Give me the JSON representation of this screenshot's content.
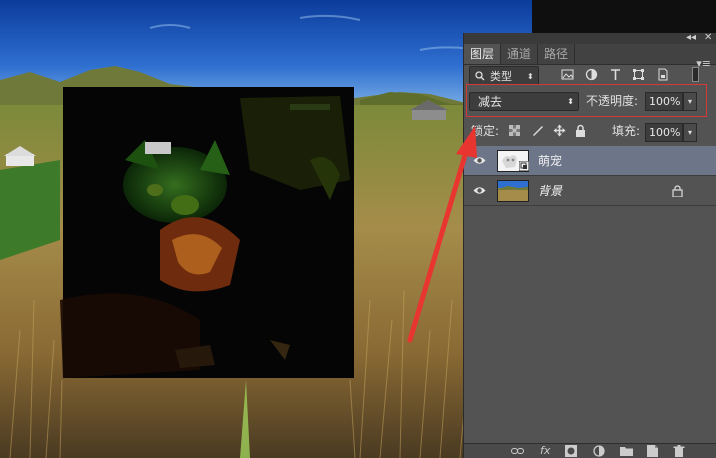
{
  "panel": {
    "tabs": [
      {
        "label": "图层",
        "active": true
      },
      {
        "label": "通道",
        "active": false
      },
      {
        "label": "路径",
        "active": false
      }
    ],
    "collapse_glyph": "◂◂",
    "close_glyph": "✕",
    "menu_glyph": "▾≡",
    "filter": {
      "kind_label": "类型",
      "icons": [
        "image-filter-icon",
        "adjustment-filter-icon",
        "type-filter-icon",
        "shape-filter-icon",
        "smart-object-filter-icon"
      ]
    },
    "blend_mode": "减去",
    "opacity_label": "不透明度:",
    "opacity_value": "100%",
    "lock_label": "锁定:",
    "fill_label": "填充:",
    "fill_value": "100%",
    "layers": [
      {
        "name": "萌宠",
        "selected": true,
        "visible": true,
        "locked": false
      },
      {
        "name": "背景",
        "selected": false,
        "visible": true,
        "locked": true
      }
    ],
    "bottom_icons": [
      "link-icon",
      "fx-icon",
      "mask-icon",
      "adjustment-icon",
      "group-folder-icon",
      "new-layer-icon",
      "trash-icon"
    ],
    "fx_label": "fx"
  },
  "colors": {
    "highlight": "#d23a3a",
    "selected_layer": "#6d7589",
    "panel_bg": "#535353"
  }
}
